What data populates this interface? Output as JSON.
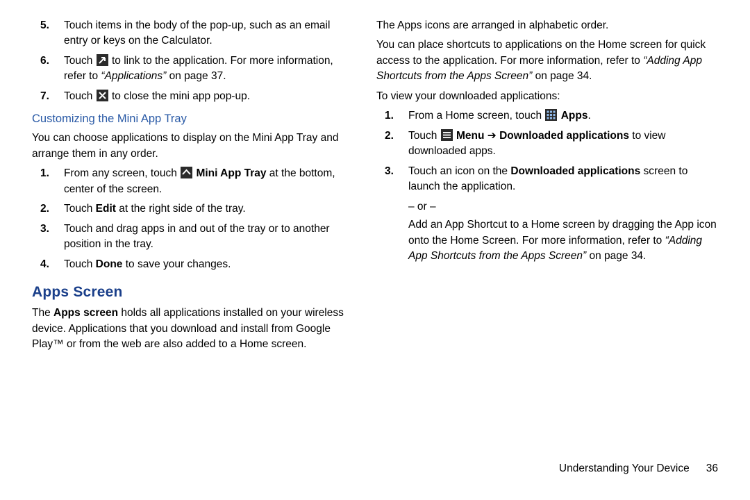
{
  "left": {
    "list1": {
      "i5": {
        "n": "5.",
        "t": "Touch items in the body of the pop-up, such as an email entry or keys on the Calculator."
      },
      "i6": {
        "n": "6.",
        "t1": "Touch ",
        "t2": " to link to the application. For more information, refer to ",
        "ref": "“Applications”",
        "t3": " on page 37."
      },
      "i7": {
        "n": "7.",
        "t1": "Touch ",
        "t2": " to close the mini app pop-up."
      }
    },
    "h_custom": "Customizing the Mini App Tray",
    "p_custom": "You can choose applications to display on the Mini App Tray and arrange them in any order.",
    "list2": {
      "i1": {
        "n": "1.",
        "t1": "From any screen, touch ",
        "b": "Mini App Tray",
        "t2": " at the bottom, center of the screen."
      },
      "i2": {
        "n": "2.",
        "t1": "Touch ",
        "b": "Edit",
        "t2": " at the right side of the tray."
      },
      "i3": {
        "n": "3.",
        "t": "Touch and drag apps in and out of the tray or to another position in the tray."
      },
      "i4": {
        "n": "4.",
        "t1": "Touch ",
        "b": "Done",
        "t2": " to save your changes."
      }
    },
    "h_apps": "Apps Screen",
    "p_apps1a": "The ",
    "p_apps1b": "Apps screen",
    "p_apps1c": " holds all applications installed on your wireless device. Applications that you download and install from Google Play™ or from the web are also added to a Home screen."
  },
  "right": {
    "p1": "The Apps icons are arranged in alphabetic order.",
    "p2a": "You can place shortcuts to applications on the Home screen for quick access to the application. For more information, refer to ",
    "p2ref": "“Adding App Shortcuts from the Apps Screen”",
    "p2b": " on page 34.",
    "p3": "To view your downloaded applications:",
    "list": {
      "i1": {
        "n": "1.",
        "t1": "From a Home screen, touch ",
        "b": "Apps",
        "t2": "."
      },
      "i2": {
        "n": "2.",
        "t1": "Touch ",
        "b1": "Menu",
        "arrow": " ➔ ",
        "b2": "Downloaded applications",
        "t2": " to view downloaded apps."
      },
      "i3": {
        "n": "3.",
        "t1": "Touch an icon on the ",
        "b": "Downloaded applications",
        "t2": " screen to launch the application."
      }
    },
    "or": "– or –",
    "extra_a": "Add an App Shortcut to a Home screen by dragging the App icon onto the Home Screen. For more information, refer to ",
    "extra_ref": "“Adding App Shortcuts from the Apps Screen”",
    "extra_b": " on page 34."
  },
  "footer": {
    "section": "Understanding Your Device",
    "page": "36"
  }
}
